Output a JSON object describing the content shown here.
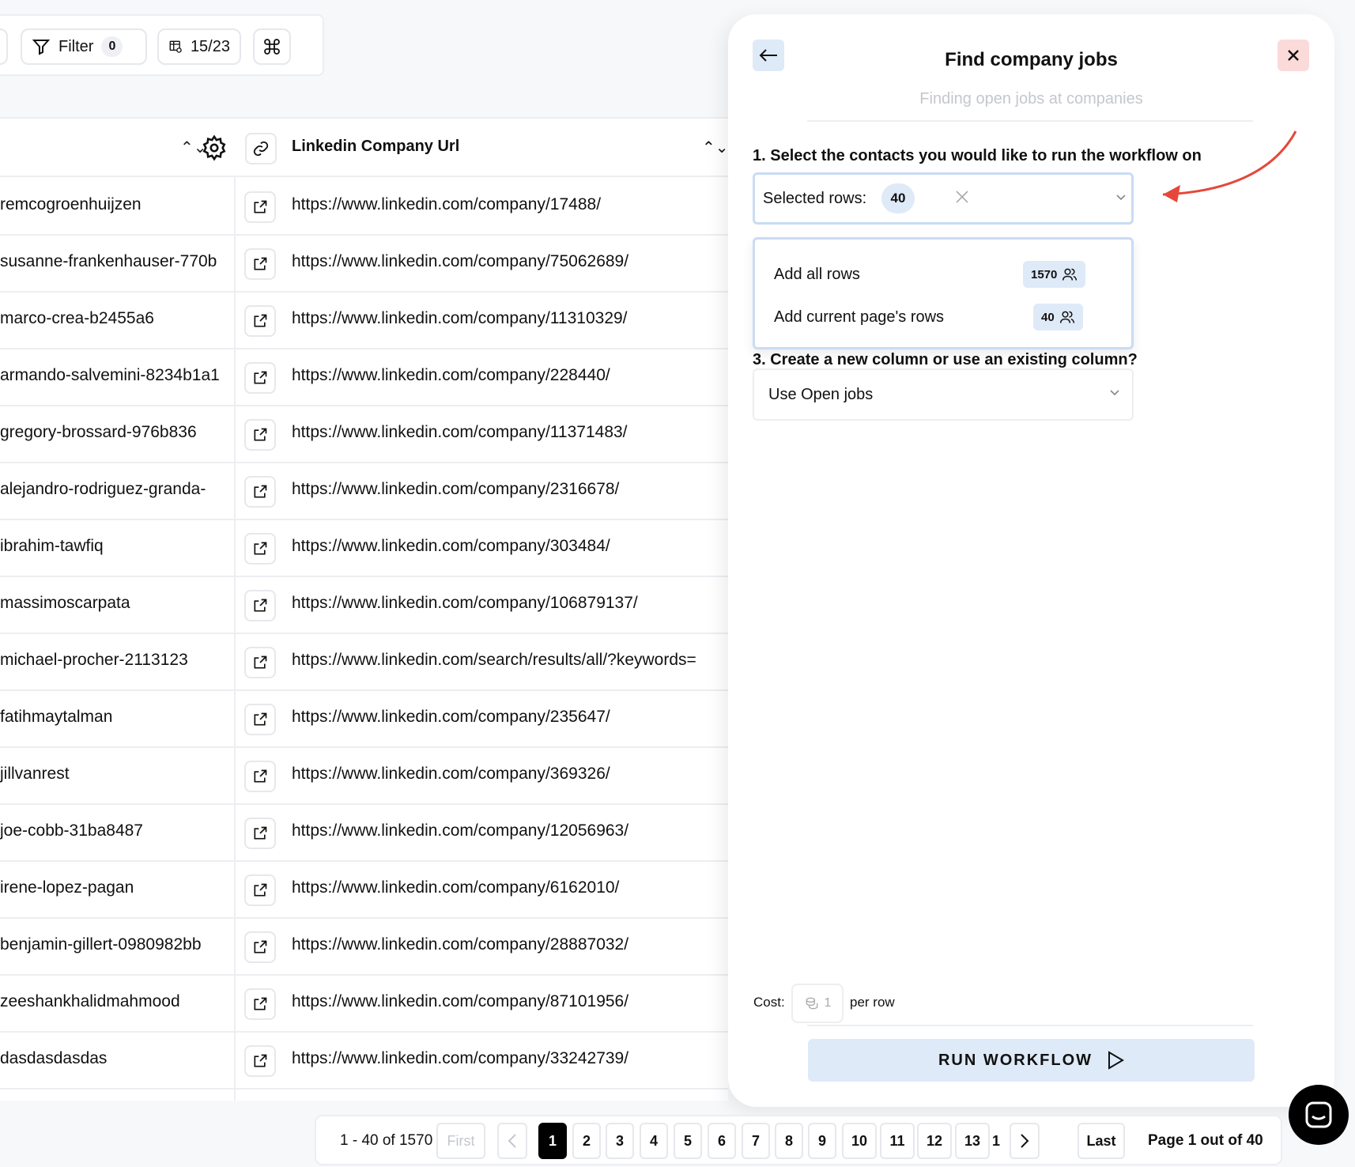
{
  "toolbar": {
    "filter_label": "Filter",
    "filter_count": "0",
    "columns_label": "15/23"
  },
  "table": {
    "column_header": "Linkedin Company Url",
    "rows": [
      {
        "name": "remcogroenhuijzen",
        "url": "https://www.linkedin.com/company/17488/"
      },
      {
        "name": "susanne-frankenhauser-770b",
        "url": "https://www.linkedin.com/company/75062689/"
      },
      {
        "name": "marco-crea-b2455a6",
        "url": "https://www.linkedin.com/company/11310329/"
      },
      {
        "name": "armando-salvemini-8234b1a1",
        "url": "https://www.linkedin.com/company/228440/"
      },
      {
        "name": "gregory-brossard-976b836",
        "url": "https://www.linkedin.com/company/11371483/"
      },
      {
        "name": "alejandro-rodriguez-granda-",
        "url": "https://www.linkedin.com/company/2316678/"
      },
      {
        "name": "ibrahim-tawfiq",
        "url": "https://www.linkedin.com/company/303484/"
      },
      {
        "name": "massimoscarpata",
        "url": "https://www.linkedin.com/company/106879137/"
      },
      {
        "name": "michael-procher-2113123",
        "url": "https://www.linkedin.com/search/results/all/?keywords="
      },
      {
        "name": "fatihmaytalman",
        "url": "https://www.linkedin.com/company/235647/"
      },
      {
        "name": "jillvanrest",
        "url": "https://www.linkedin.com/company/369326/"
      },
      {
        "name": "joe-cobb-31ba8487",
        "url": "https://www.linkedin.com/company/12056963/"
      },
      {
        "name": "irene-lopez-pagan",
        "url": "https://www.linkedin.com/company/6162010/"
      },
      {
        "name": "benjamin-gillert-0980982bb",
        "url": "https://www.linkedin.com/company/28887032/"
      },
      {
        "name": "zeeshankhalidmahmood",
        "url": "https://www.linkedin.com/company/87101956/"
      },
      {
        "name": "dasdasdasdas",
        "url": "https://www.linkedin.com/company/33242739/"
      }
    ]
  },
  "panel": {
    "title": "Find company jobs",
    "subtitle": "Finding open jobs at companies",
    "step1_label": "1. Select the contacts you would like to run the workflow on",
    "selected_rows_label": "Selected rows:",
    "selected_rows_count": "40",
    "dropdown": {
      "add_all_label": "Add all rows",
      "add_all_count": "1570",
      "add_page_label": "Add current page's rows",
      "add_page_count": "40"
    },
    "step3_label": "3. Create a new column or use an existing column?",
    "column_select_value": "Use Open jobs",
    "cost_label": "Cost:",
    "cost_value": "1",
    "cost_unit": "per row",
    "run_label": "RUN WORKFLOW"
  },
  "pagination": {
    "range": "1 - 40 of 1570",
    "first": "First",
    "pages": [
      "1",
      "2",
      "3",
      "4",
      "5",
      "6",
      "7",
      "8",
      "9",
      "10",
      "11",
      "12",
      "13",
      "1"
    ],
    "last": "Last",
    "info": "Page 1 out of 40"
  },
  "colors": {
    "accent_light": "#dfeaf8",
    "close_bg": "#fbdada",
    "annotation_arrow": "#e5483a"
  }
}
